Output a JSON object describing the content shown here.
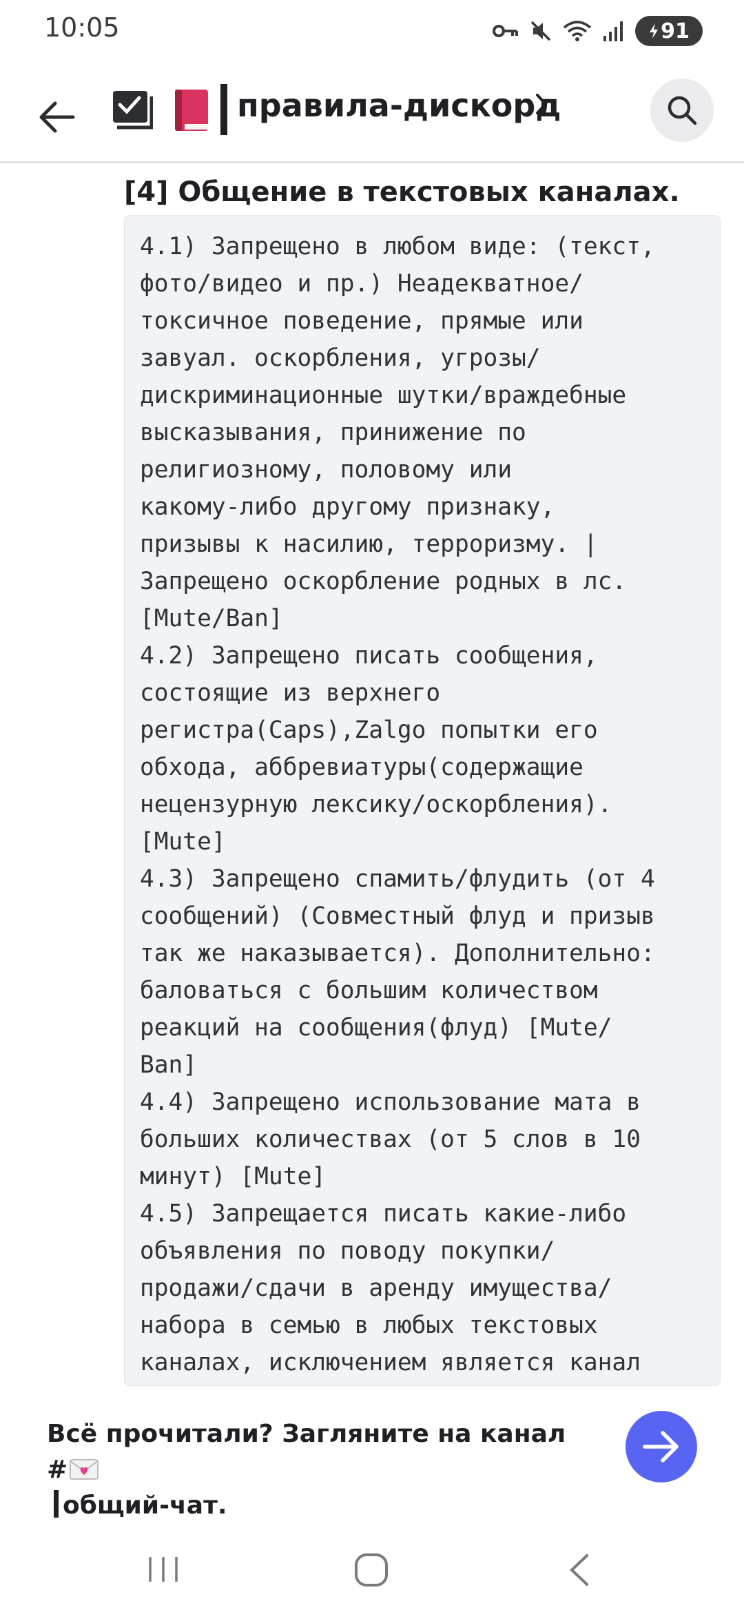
{
  "status_bar": {
    "time": "10:05",
    "battery": "91",
    "icons": [
      "key-icon",
      "mute-icon",
      "wifi-icon",
      "signal-icon",
      "battery-icon"
    ]
  },
  "header": {
    "channel_name": "правила-дискорд",
    "icons": [
      "back-arrow-icon",
      "channel-checklist-icon",
      "book-emoji-icon",
      "chevron-right-icon",
      "search-icon"
    ]
  },
  "content": {
    "heading": "[4] Общение в текстовых каналах.",
    "rule_lines": [
      "4.1) Запрещено в любом виде: (текст,",
      "фото/видео и пр.) Неадекватное/",
      "токсичное поведение, прямые или",
      "завуал. оскорбления, угрозы/",
      "дискриминационные шутки/враждебные",
      "высказывания, принижение по",
      "религиозному, половому или",
      "какому-либо другому признаку,",
      "призывы к насилию, терроризму. |",
      "Запрещено оскорбление родных в лс.",
      "[Mute/Ban]",
      "4.2) Запрещено писать сообщения,",
      "состоящие из верхнего",
      "регистра(Caps),Zalgo попытки его",
      "обхода, аббревиатуры(содержащие",
      "нецензурную лексику/оскорбления).",
      "[Mute]",
      "4.3) Запрещено спамить/флудить (от 4",
      "сообщений) (Совместный флуд и призыв",
      "так же наказывается). Дополнительно:",
      "баловаться с большим количеством",
      "реакций на сообщения(флуд) [Mute/",
      "Ban]",
      "4.4) Запрещено использование мата в",
      "больших количествах (от 5 слов в 10",
      "минут) [Mute]",
      "4.5) Запрещается писать какие-либо",
      "объявления по поводу покупки/",
      "продажи/сдачи в аренду имущества/",
      "набора в семью в любых текстовых",
      "каналах, исключением является канал"
    ]
  },
  "banner": {
    "text_part1": "Всё прочитали? Загляните на канал #",
    "text_part2": "общий-чат.",
    "icons": [
      "love-letter-emoji-icon",
      "arrow-right-icon"
    ]
  },
  "nav": {
    "icons": [
      "recents-icon",
      "home-icon",
      "back-icon"
    ]
  },
  "colors": {
    "accent": "#5865f2",
    "code_bg": "#f2f3f5",
    "text": "#1f2024"
  }
}
